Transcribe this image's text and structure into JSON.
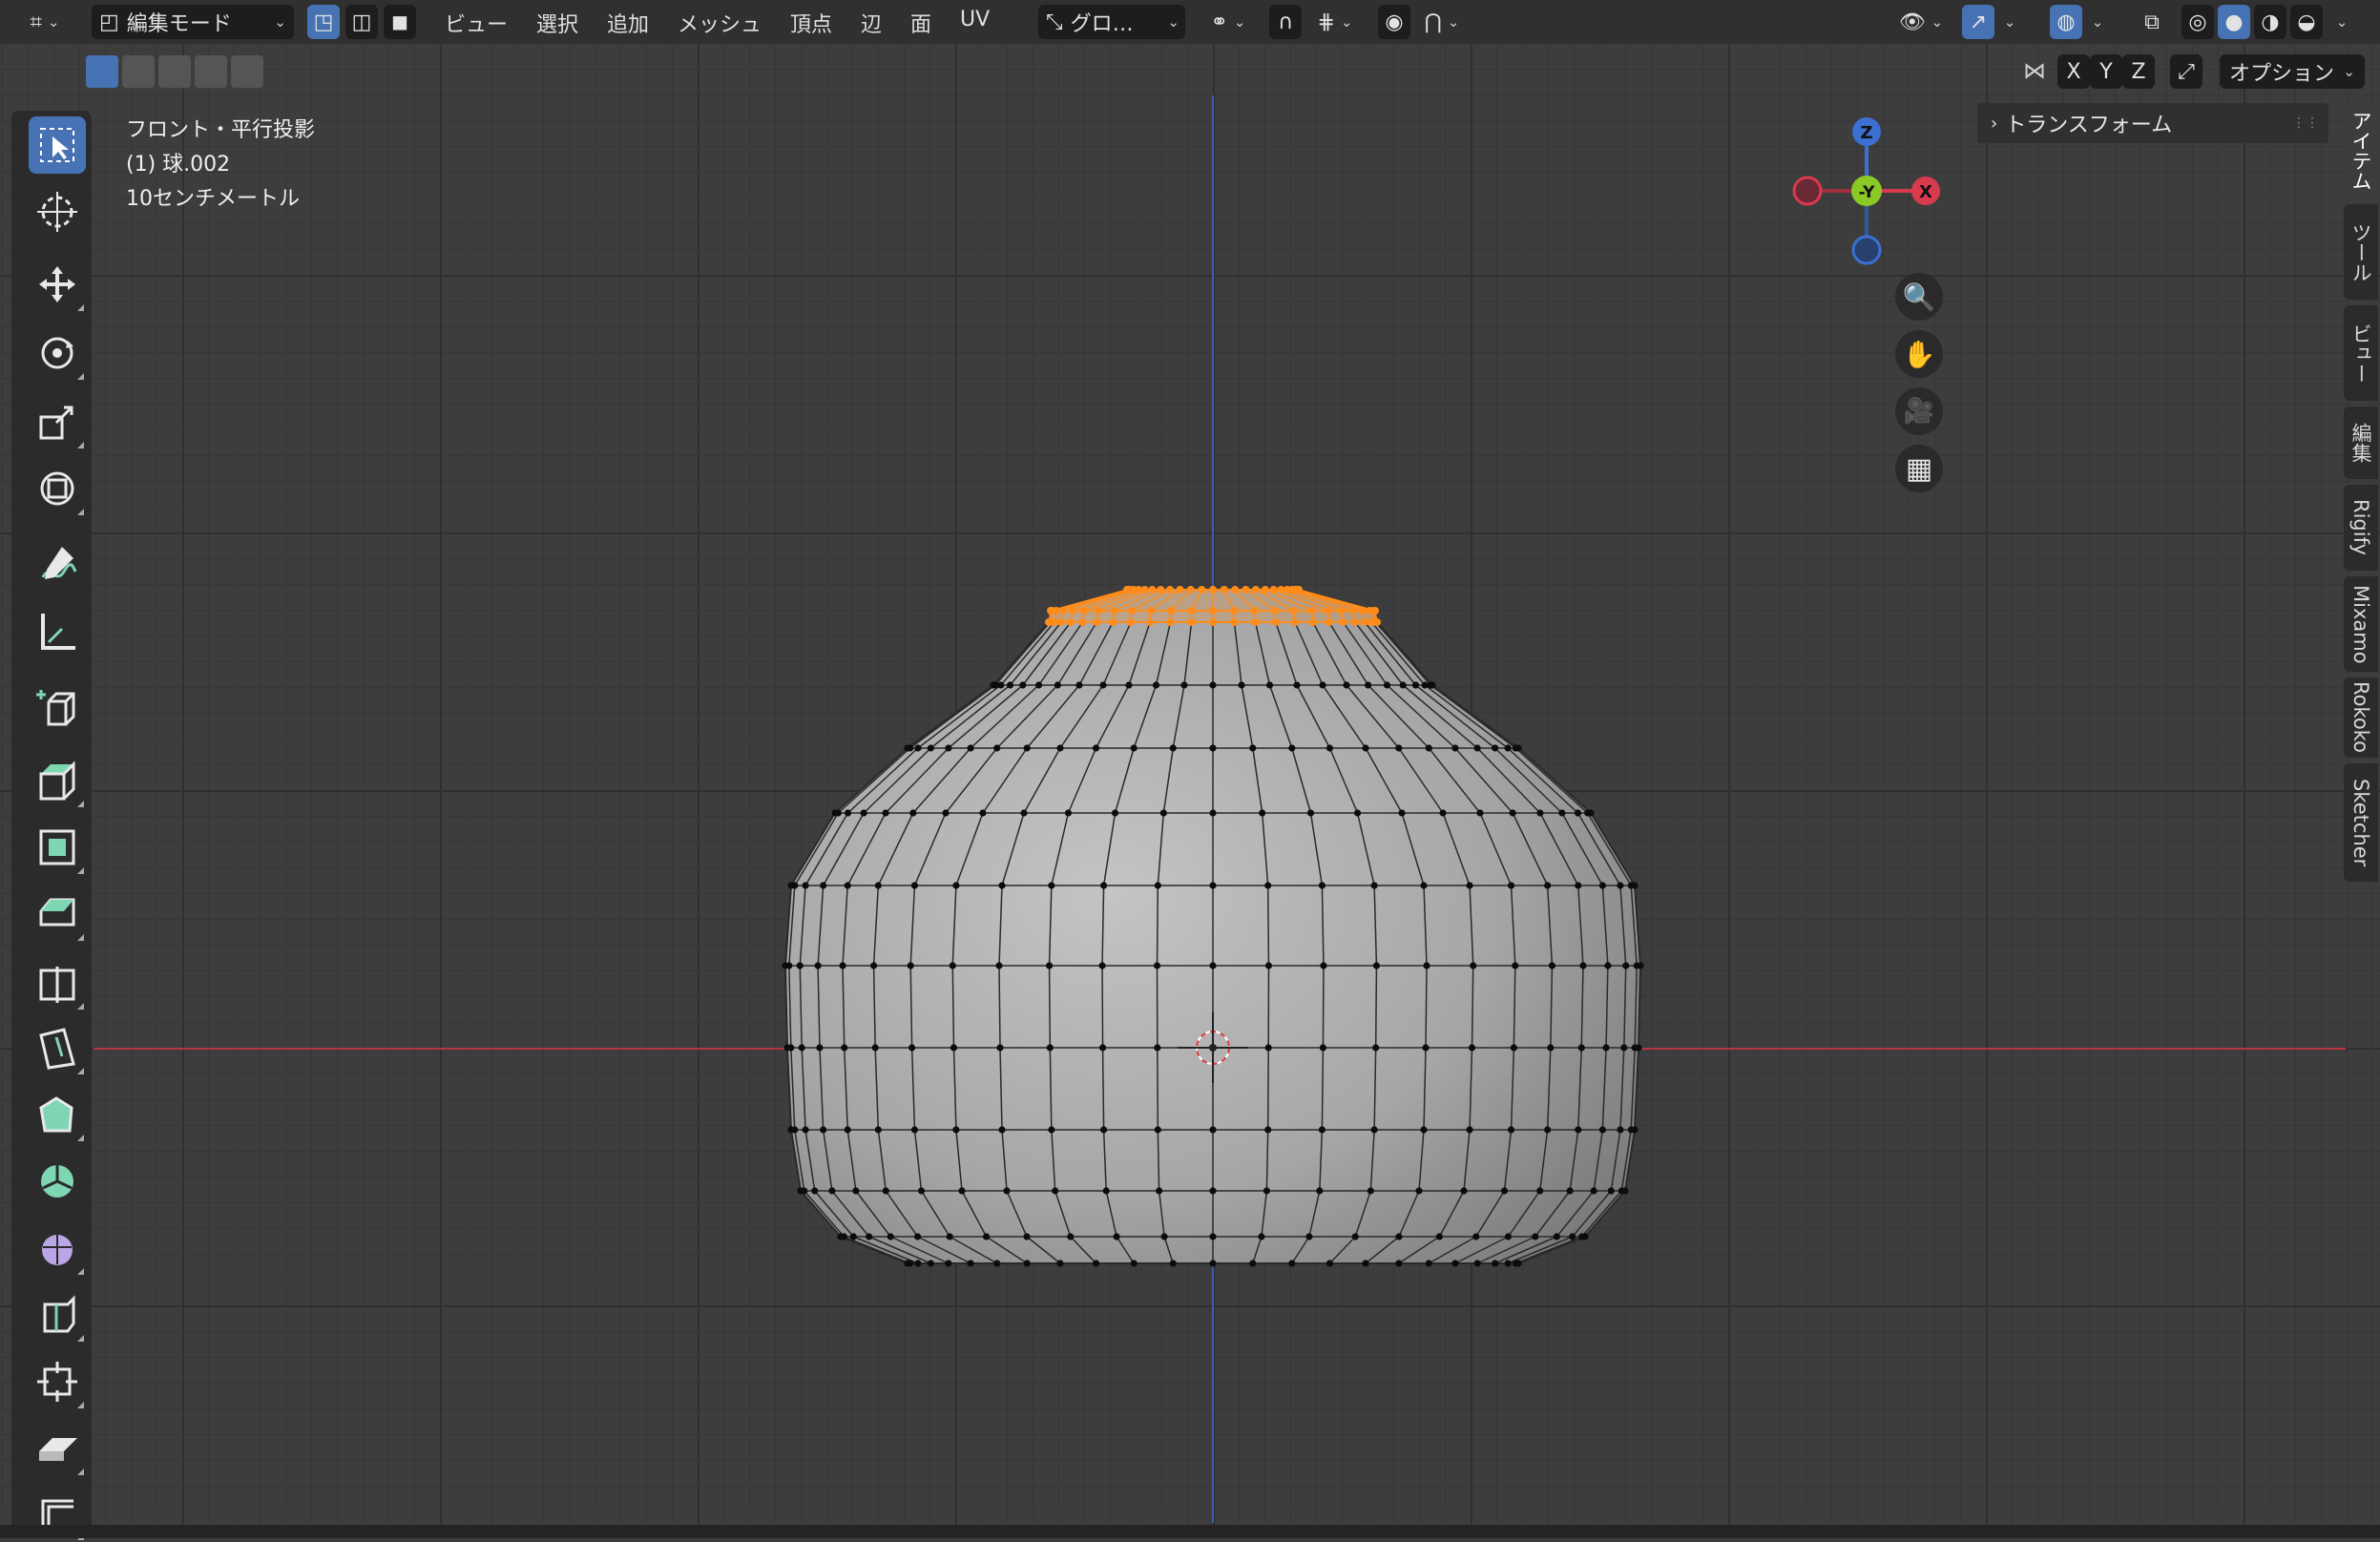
{
  "header": {
    "mode_label": "編集モード",
    "menus": [
      "ビュー",
      "選択",
      "追加",
      "メッシュ",
      "頂点",
      "辺",
      "面",
      "UV"
    ],
    "transform_orientation": "グロ…",
    "options_label": "オプション",
    "mirror_axes": [
      "X",
      "Y",
      "Z"
    ]
  },
  "viewport": {
    "view_name": "フロント・平行投影",
    "object_name": "(1) 球.002",
    "scale": "10センチメートル"
  },
  "gizmo": {
    "z": "Z",
    "y": "-Y",
    "x": "X"
  },
  "npanel": {
    "section": "トランスフォーム"
  },
  "side_tabs": [
    "アイテム",
    "ツール",
    "ビュー",
    "編集",
    "Rigify",
    "Mixamo",
    "Rokoko",
    "Sketcher"
  ],
  "colors": {
    "accent": "#4772b3",
    "selected": "#ff8c1a",
    "x_axis": "#b83444",
    "z_axis": "#3c5fb0",
    "y_axis": "#8ac926"
  }
}
